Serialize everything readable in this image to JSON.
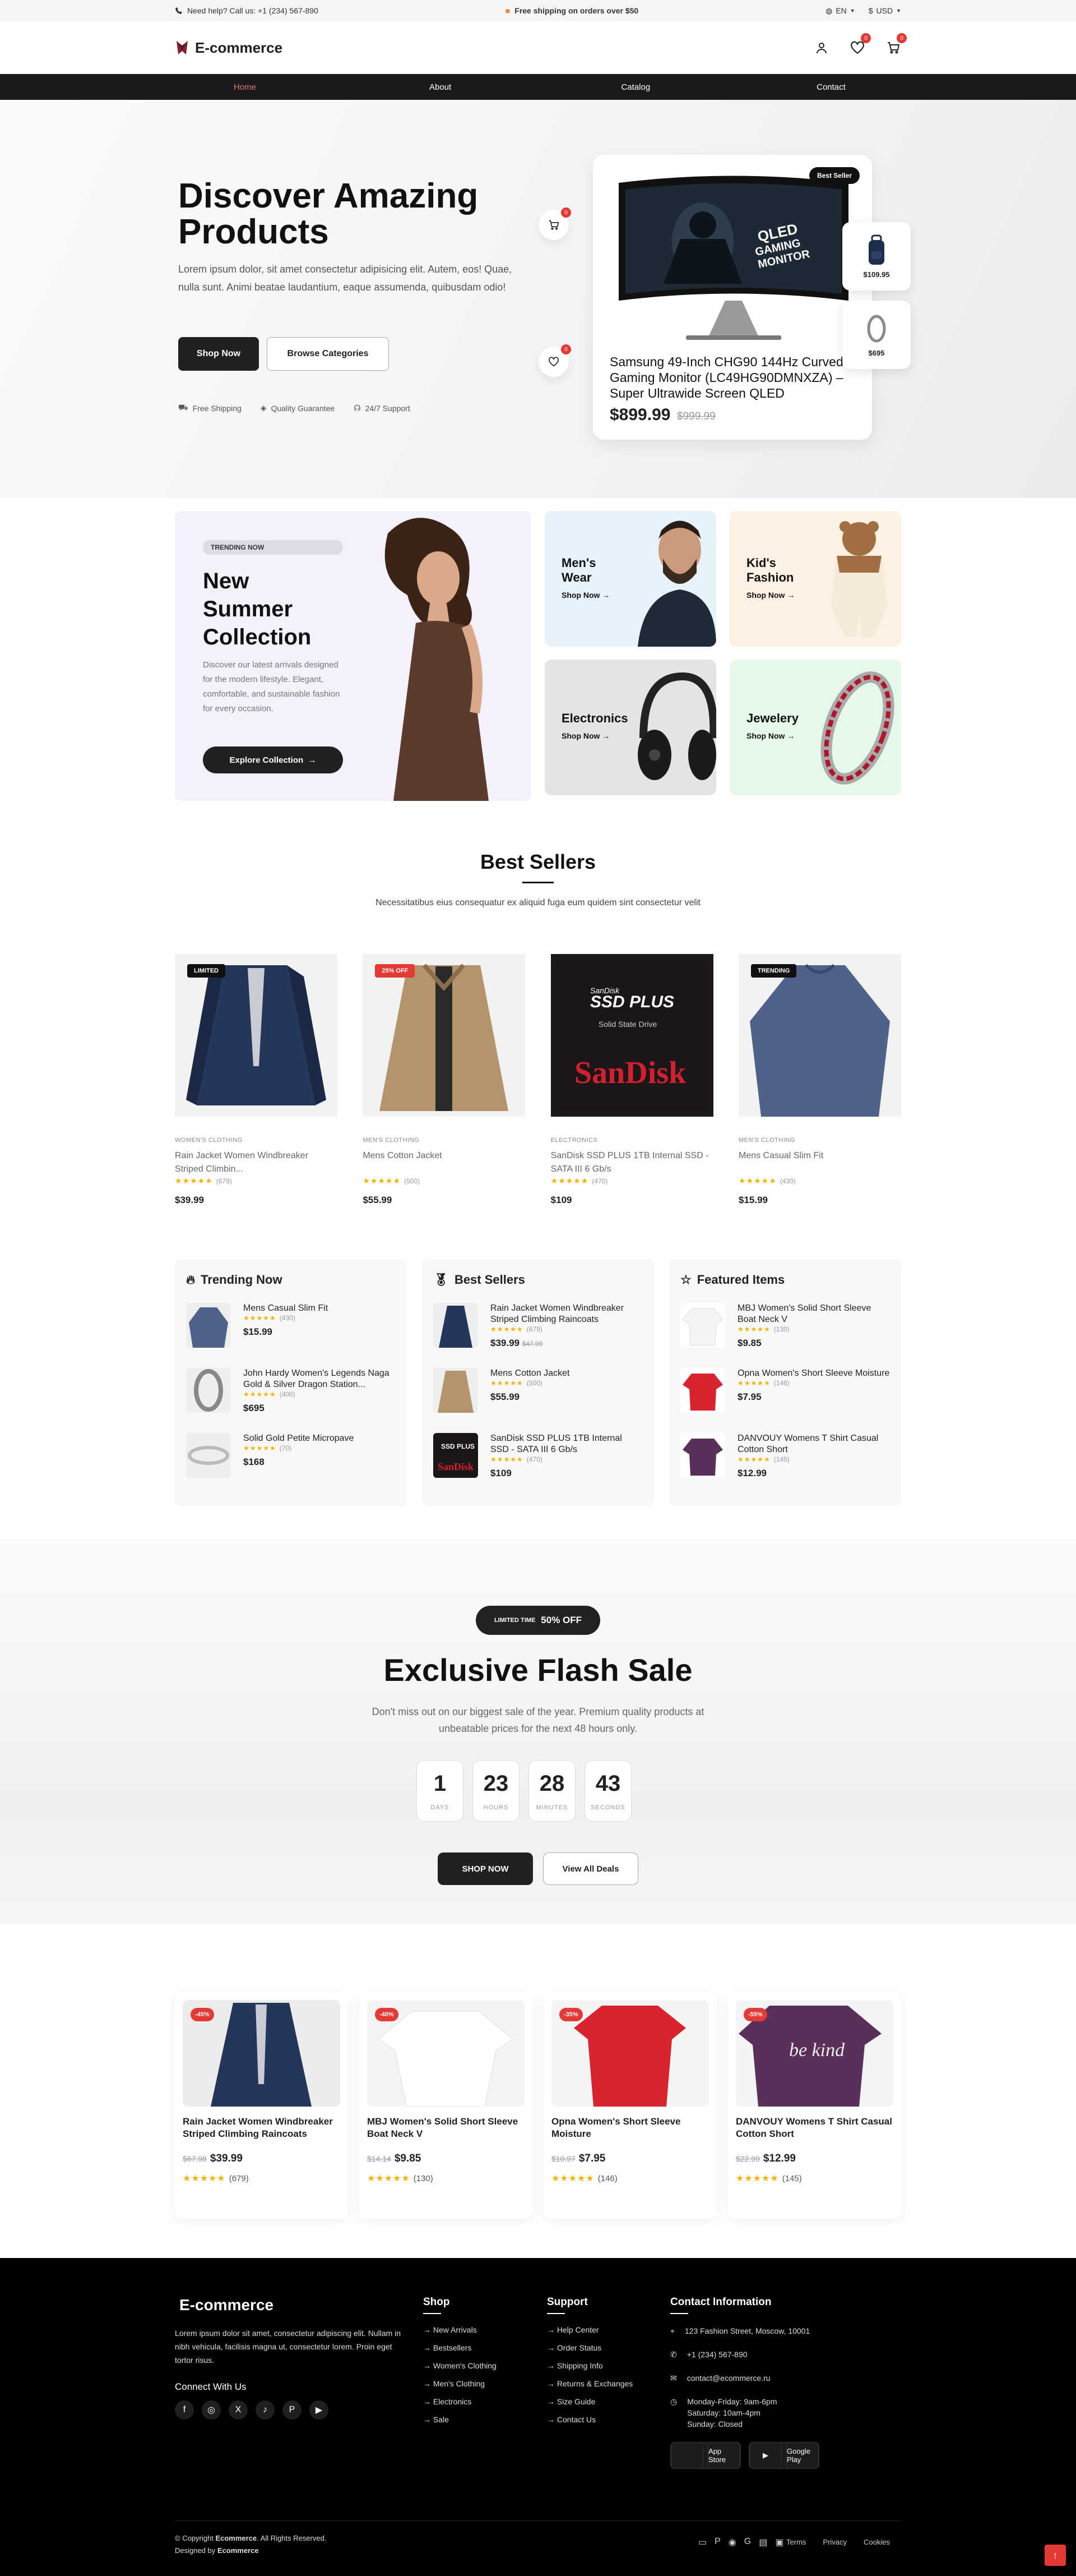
{
  "topbar": {
    "help": "Need help? Call us: +1 (234) 567-890",
    "promo": "Free shipping on orders over $50",
    "lang": "EN",
    "currency": "USD"
  },
  "header": {
    "brand": "E-commerce",
    "wishlist_count": "0",
    "cart_count": "0"
  },
  "nav": [
    {
      "label": "Home"
    },
    {
      "label": "About"
    },
    {
      "label": "Catalog"
    },
    {
      "label": "Contact"
    }
  ],
  "hero": {
    "title_line1": "Discover Amazing",
    "title_line2": "Products",
    "desc": "Lorem ipsum dolor, sit amet consectetur adipisicing elit. Autem, eos! Quae, nulla sunt. Animi beatae laudantium, eaque assumenda, quibusdam odio!",
    "btn_shop": "Shop Now",
    "btn_browse": "Browse Categories",
    "features": [
      "Free Shipping",
      "Quality Guarantee",
      "24/7 Support"
    ],
    "card": {
      "tag": "Best Seller",
      "name": "Samsung 49-Inch CHG90 144Hz Curved Gaming Monitor (LC49HG90DMNXZA) – Super Ultrawide Screen QLED",
      "price": "$899.99",
      "old_price": "$999.99"
    },
    "mini1_price": "$109.95",
    "mini2_price": "$695",
    "float_cart_count": "0",
    "float_wish_count": "0"
  },
  "categories": {
    "featured": {
      "pill": "TRENDING NOW",
      "title_line1": "New",
      "title_line2": "Summer",
      "title_line3": "Collection",
      "desc": "Discover our latest arrivals designed for the modern lifestyle. Elegant, comfortable, and sustainable fashion for every occasion.",
      "btn": "Explore Collection"
    },
    "items": [
      {
        "title_line1": "Men's",
        "title_line2": "Wear",
        "shop": "Shop Now"
      },
      {
        "title_line1": "Kid's",
        "title_line2": "Fashion",
        "shop": "Shop Now"
      },
      {
        "title_line1": "Electronics",
        "shop": "Shop Now"
      },
      {
        "title_line1": "Jewelery",
        "shop": "Shop Now"
      }
    ]
  },
  "bestsellers": {
    "title": "Best Sellers",
    "subtitle": "Necessitatibus eius consequatur ex aliquid fuga eum quidem sint consectetur velit",
    "products": [
      {
        "label": "LIMITED",
        "category": "WOMEN'S CLOTHING",
        "name": "Rain Jacket Women Windbreaker Striped Climbin...",
        "count": "(679)",
        "price": "$39.99"
      },
      {
        "label": "25% OFF",
        "category": "MEN'S CLOTHING",
        "name": "Mens Cotton Jacket",
        "count": "(500)",
        "price": "$55.99"
      },
      {
        "label": "",
        "category": "ELECTRONICS",
        "name": "SanDisk SSD PLUS 1TB Internal SSD - SATA III 6 Gb/s",
        "count": "(470)",
        "price": "$109"
      },
      {
        "label": "TRENDING",
        "category": "MEN'S CLOTHING",
        "name": "Mens Casual Slim Fit",
        "count": "(430)",
        "price": "$15.99"
      }
    ]
  },
  "lists": [
    {
      "title": "Trending Now",
      "items": [
        {
          "name": "Mens Casual Slim Fit",
          "count": "(430)",
          "price": "$15.99"
        },
        {
          "name": "John Hardy Women's Legends Naga Gold & Silver Dragon Station...",
          "count": "(400)",
          "price": "$695"
        },
        {
          "name": "Solid Gold Petite Micropave",
          "count": "(70)",
          "price": "$168"
        }
      ]
    },
    {
      "title": "Best Sellers",
      "items": [
        {
          "name": "Rain Jacket Women Windbreaker Striped Climbing Raincoats",
          "count": "(679)",
          "price": "$39.99",
          "old": "$47.99"
        },
        {
          "name": "Mens Cotton Jacket",
          "count": "(500)",
          "price": "$55.99",
          "old": ""
        },
        {
          "name": "SanDisk SSD PLUS 1TB Internal SSD - SATA III 6 Gb/s",
          "count": "(470)",
          "price": "$109",
          "old": ""
        }
      ]
    },
    {
      "title": "Featured Items",
      "items": [
        {
          "name": "MBJ Women's Solid Short Sleeve Boat Neck V",
          "count": "(130)",
          "price": "$9.85"
        },
        {
          "name": "Opna Women's Short Sleeve Moisture",
          "count": "(146)",
          "price": "$7.95"
        },
        {
          "name": "DANVOUY Womens T Shirt Casual Cotton Short",
          "count": "(145)",
          "price": "$12.99"
        }
      ]
    }
  ],
  "flash": {
    "pill_small": "LIMITED TIME",
    "pill_big": "50% OFF",
    "title": "Exclusive Flash Sale",
    "desc": "Don't miss out on our biggest sale of the year. Premium quality products at unbeatable prices for the next 48 hours only.",
    "countdown": [
      {
        "n": "1",
        "u": "DAYS"
      },
      {
        "n": "23",
        "u": "HOURS"
      },
      {
        "n": "28",
        "u": "MINUTES"
      },
      {
        "n": "43",
        "u": "SECONDS"
      }
    ],
    "btn_shop": "SHOP NOW",
    "btn_all": "View All Deals",
    "deals": [
      {
        "off": "-45%",
        "name": "Rain Jacket Women Windbreaker Striped Climbing Raincoats",
        "old": "$67.98",
        "price": "$39.99",
        "count": "(679)"
      },
      {
        "off": "-40%",
        "name": "MBJ Women's Solid Short Sleeve Boat Neck V",
        "old": "$14.14",
        "price": "$9.85",
        "count": "(130)"
      },
      {
        "off": "-35%",
        "name": "Opna Women's Short Sleeve Moisture",
        "old": "$10.97",
        "price": "$7.95",
        "count": "(146)"
      },
      {
        "off": "-55%",
        "name": "DANVOUY Womens T Shirt Casual Cotton Short",
        "old": "$22.99",
        "price": "$12.99",
        "count": "(145)"
      }
    ]
  },
  "footer": {
    "brand": "E-commerce",
    "about": "Lorem ipsum dolor sit amet, consectetur adipiscing elit. Nullam in nibh vehicula, facilisis magna ut, consectetur lorem. Proin eget tortor risus.",
    "connect": "Connect With Us",
    "shop_title": "Shop",
    "shop": [
      "→ New Arrivals",
      "→ Bestsellers",
      "→ Women's Clothing",
      "→ Men's Clothing",
      "→ Electronics",
      "→ Sale"
    ],
    "support_title": "Support",
    "support": [
      "→ Help Center",
      "→ Order Status",
      "→ Shipping Info",
      "→ Returns & Exchanges",
      "→ Size Guide",
      "→ Contact Us"
    ],
    "contact_title": "Contact Information",
    "address": "123 Fashion Street, Moscow, 10001",
    "phone": "+1 (234) 567-890",
    "email": "contact@ecommerce.ru",
    "hours1": "Monday-Friday: 9am-6pm",
    "hours2": "Saturday: 10am-4pm",
    "hours3": "Sunday: Closed",
    "appstore": "App Store",
    "googleplay": "Google Play",
    "copyright": "© Copyright",
    "copyright_brand": "Ecommerce",
    "copyright_rest": ". All Rights Reserved.",
    "designed": "Designed by",
    "designed_brand": "Ecommerce",
    "links": [
      "Terms",
      "Privacy",
      "Cookies"
    ]
  }
}
